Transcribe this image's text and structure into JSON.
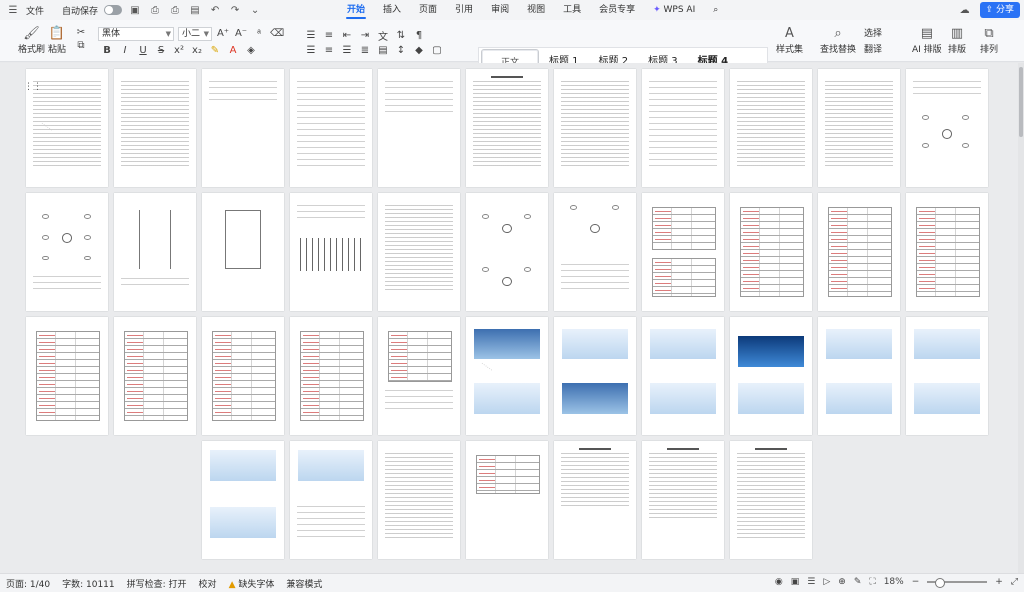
{
  "menubar": {
    "file": "文件",
    "autosave": "自动保存",
    "tabs": [
      "开始",
      "插入",
      "页面",
      "引用",
      "审阅",
      "视图",
      "工具",
      "会员专享"
    ],
    "active_tab": "开始",
    "wps_ai": "WPS AI",
    "share": "分享"
  },
  "ribbon": {
    "format_painter": "格式刷",
    "paste": "粘贴",
    "font_name": "黑体",
    "font_size": "小二",
    "styles": [
      "正文",
      "标题 1",
      "标题 2",
      "标题 3",
      "标题 4"
    ],
    "style_set": "样式集",
    "find_replace": "查找替换",
    "select": "选择",
    "translate": "翻译",
    "ai_layout": "AI 排版",
    "layout": "排版",
    "arrange": "排列"
  },
  "statusbar": {
    "page": "页面: 1/40",
    "words": "字数: 10111",
    "spellcheck": "拼写检查: 打开",
    "proofread": "校对",
    "missing_font": "缺失字体",
    "compat_mode": "兼容模式",
    "zoom": "18%"
  },
  "icons": {
    "undo": "undo-icon",
    "redo": "redo-icon",
    "search": "search-icon",
    "cloud": "cloud-icon",
    "warning": "warning-icon"
  },
  "colors": {
    "accent": "#1f6df0",
    "share_bg": "#2a72f5",
    "watermark": "#c9c9c9"
  }
}
